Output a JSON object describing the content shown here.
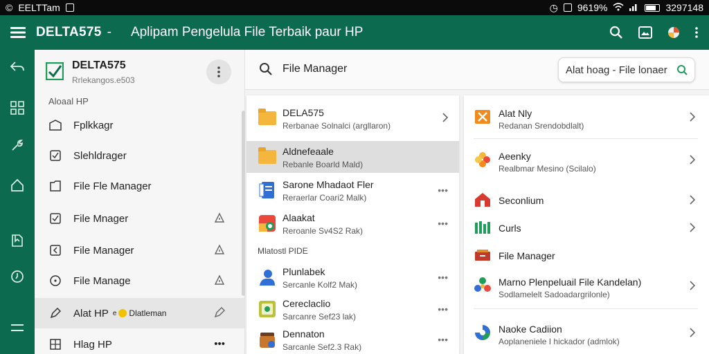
{
  "status_bar": {
    "left_text": "EELTTam",
    "right_percent": "9619%",
    "time": "3297148"
  },
  "app_bar": {
    "brand": "DELTA575",
    "separator": "-",
    "subtitle": "Aplipam Pengelula File Terbaik paur HP"
  },
  "account": {
    "name": "DELTA575",
    "subtitle": "Rrlekangos.e503"
  },
  "left_panel": {
    "section_label": "Aloaal HP",
    "items": [
      {
        "label": "Fplkkagr"
      },
      {
        "label": "Slehldrager"
      },
      {
        "label": "File Fle Manager"
      },
      {
        "label": "File Mnager"
      },
      {
        "label": "File Manager"
      },
      {
        "label": "File Manage"
      },
      {
        "label": "Alat HP",
        "suffix": "Dlatleman",
        "prefix_part": "e"
      },
      {
        "label": "Hlag HP"
      }
    ]
  },
  "search": {
    "query": "File Manager",
    "filter_label": "Alat hoag - File lonaer"
  },
  "file_list": {
    "top_rows": [
      {
        "title": "DELA575",
        "subtitle": "Rerbanae Solnalci (argllaron)"
      },
      {
        "title": "Aldnefeaale",
        "subtitle": "Rebanle Boarld Mald)"
      },
      {
        "title": "Sarone Mhadaot Fler",
        "subtitle": "Reraerlar Coari2 Malk)"
      },
      {
        "title": "Alaakat",
        "subtitle": "Reroanle Sv4S2 Rak)"
      }
    ],
    "section_label": "Mlatostl PIDE",
    "bottom_rows": [
      {
        "title": "Plunlabek",
        "subtitle": "Sercanle Kolf2 Mak)"
      },
      {
        "title": "Cereclaclio",
        "subtitle": "Sarcanre Sef23 lak)"
      },
      {
        "title": "Dennaton",
        "subtitle": "Sarcanle Sef2.3 Rak)"
      }
    ]
  },
  "tools": {
    "items": [
      {
        "title": "Alat Nly",
        "subtitle": "Redanan Srendobdlalt)"
      },
      {
        "title": "Aeenky",
        "subtitle": "Realbmar Mesino (Scilalo)"
      },
      {
        "title": "Seconlium"
      },
      {
        "title": "Curls"
      },
      {
        "title": "File Manager"
      },
      {
        "title": "Marno Plenpeluail File Kandelan)",
        "subtitle": "Sodlamelelt Sadoadargrilonle)"
      },
      {
        "title": "Naoke Cadiion",
        "subtitle": "Aoplaneniele I hickador (admlok)"
      }
    ]
  },
  "colors": {
    "primary": "#0c6a4e",
    "folder": "#f4b63c",
    "accent_green": "#1f9e5a"
  }
}
